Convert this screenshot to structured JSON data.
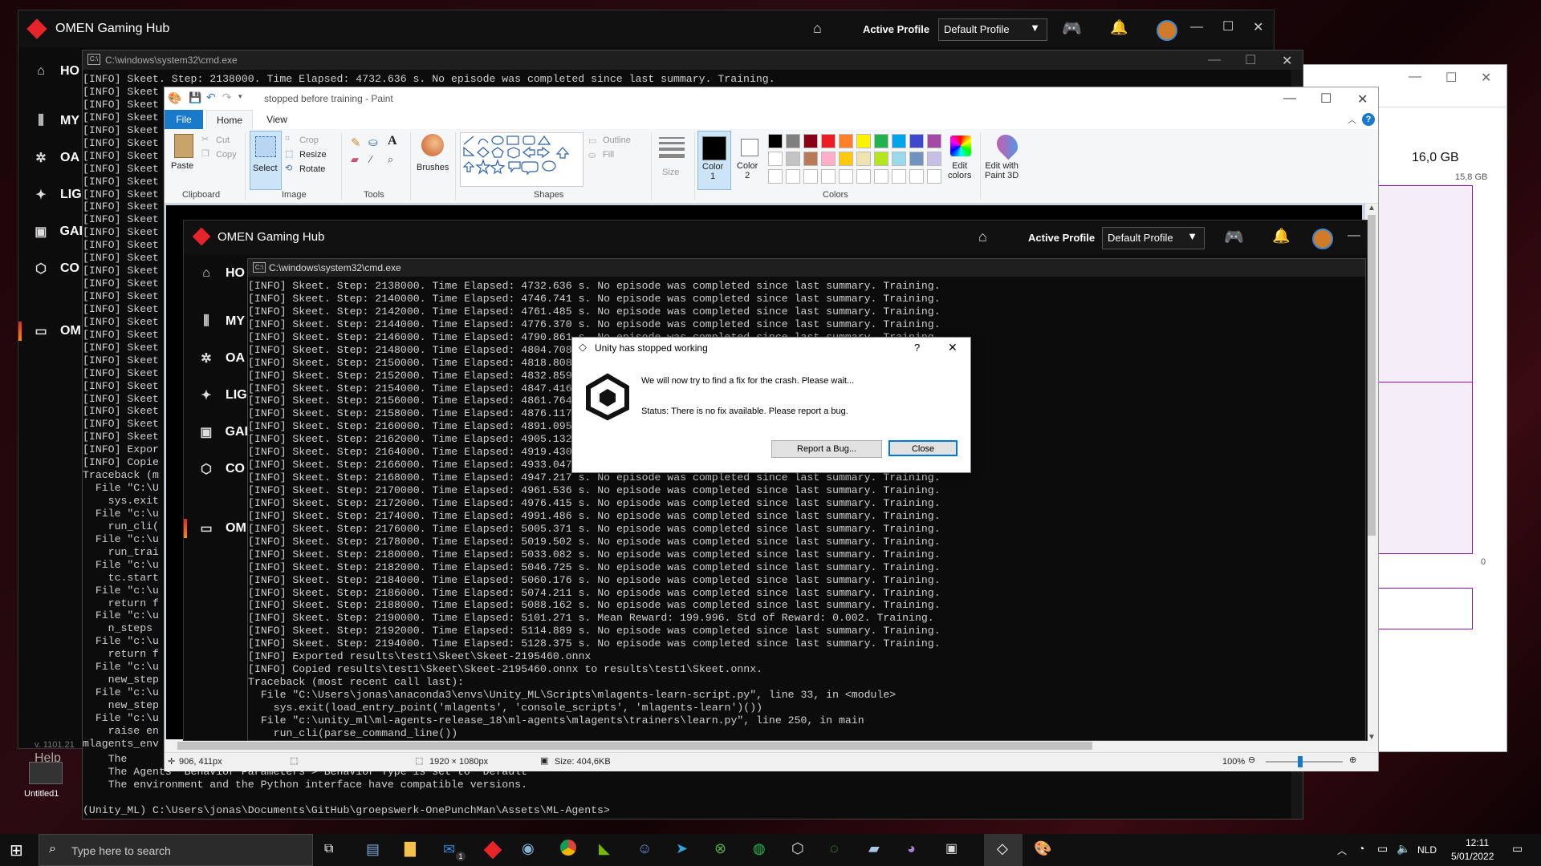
{
  "omen_back": {
    "title": "OMEN Gaming Hub",
    "active_profile_label": "Active Profile",
    "profile_value": "Default Profile",
    "nav": [
      "HO",
      "MY",
      "OA",
      "LIG",
      "GAI",
      "CO",
      "OM"
    ],
    "version": "v. 1101.21",
    "help": "Help"
  },
  "cmd_back": {
    "title": "C:\\windows\\system32\\cmd.exe",
    "first_line": "[INFO] Skeet. Step: 2138000. Time Elapsed: 4732.636 s. No episode was completed since last summary. Training.",
    "left_lines": [
      "[INFO] Skeet",
      "[INFO] Skeet",
      "[INFO] Skeet",
      "[INFO] Skeet",
      "[INFO] Skeet",
      "[INFO] Skeet",
      "[INFO] Skeet",
      "[INFO] Skeet",
      "[INFO] Skeet",
      "[INFO] Skeet",
      "[INFO] Skeet",
      "[INFO] Skeet",
      "[INFO] Skeet",
      "[INFO] Skeet",
      "[INFO] Skeet",
      "[INFO] Skeet",
      "[INFO] Skeet",
      "[INFO] Skeet",
      "[INFO] Skeet",
      "[INFO] Skeet",
      "[INFO] Skeet",
      "[INFO] Skeet",
      "[INFO] Skeet",
      "[INFO] Skeet",
      "[INFO] Skeet",
      "[INFO] Skeet",
      "[INFO] Skeet",
      "[INFO] Skeet",
      "[INFO] Expor",
      "[INFO] Copie",
      "Traceback (m",
      "  File \"C:\\U",
      "    sys.exit",
      "  File \"c:\\u",
      "    run_cli(",
      "  File \"c:\\u",
      "    run_trai",
      "  File \"c:\\u",
      "    tc.start",
      "  File \"c:\\u",
      "    return f",
      "  File \"c:\\u",
      "    n_steps",
      "  File \"c:\\u",
      "    return f",
      "  File \"c:\\u",
      "    new_step",
      "  File \"c:\\u",
      "    new_step",
      "  File \"c:\\u",
      "    raise en",
      "mlagents_env"
    ],
    "bottom_lines": [
      "    The",
      "    The Agents' Behavior Parameters > Behavior Type is set to \"Default\"",
      "    The environment and the Python interface have compatible versions.",
      "",
      "(Unity_ML) C:\\Users\\jonas\\Documents\\GitHub\\groepswerk-OnePunchMan\\Assets\\ML-Agents>"
    ]
  },
  "taskmgr": {
    "mem_total": "16,0 GB",
    "mem_avail": "15,8 GB",
    "zero": "0"
  },
  "paint": {
    "title": "stopped before training - Paint",
    "tabs": [
      "File",
      "Home",
      "View"
    ],
    "clipboard": {
      "paste": "Paste",
      "cut": "Cut",
      "copy": "Copy",
      "group": "Clipboard"
    },
    "image": {
      "select": "Select",
      "crop": "Crop",
      "resize": "Resize",
      "rotate": "Rotate",
      "group": "Image"
    },
    "tools_group": "Tools",
    "brushes": "Brushes",
    "shapes": {
      "outline": "Outline",
      "fill": "Fill",
      "group": "Shapes"
    },
    "size": "Size",
    "color1": "Color\n1",
    "color2": "Color\n2",
    "edit_colors": "Edit\ncolors",
    "edit_paint3d": "Edit with\nPaint 3D",
    "colors_group": "Colors",
    "palette_row1": [
      "#000000",
      "#7f7f7f",
      "#880015",
      "#ed1c24",
      "#ff7f27",
      "#fff200",
      "#22b14c",
      "#00a2e8",
      "#3f48cc",
      "#a349a4"
    ],
    "palette_row2": [
      "#ffffff",
      "#c3c3c3",
      "#b97a57",
      "#ffaec9",
      "#ffc90e",
      "#efe4b0",
      "#b5e61d",
      "#99d9ea",
      "#7092be",
      "#c8bfe7"
    ],
    "status_pos": "906, 411px",
    "status_dims": "1920 × 1080px",
    "status_size": "Size: 404,6KB",
    "zoom": "100%"
  },
  "omen_front": {
    "title": "OMEN Gaming Hub",
    "active_profile_label": "Active Profile",
    "profile_value": "Default Profile",
    "nav": [
      "HO",
      "MY",
      "OA",
      "LIG",
      "GAI",
      "CO",
      "OM"
    ]
  },
  "cmd_front": {
    "title": "C:\\windows\\system32\\cmd.exe",
    "lines": [
      "[INFO] Skeet. Step: 2138000. Time Elapsed: 4732.636 s. No episode was completed since last summary. Training.",
      "[INFO] Skeet. Step: 2140000. Time Elapsed: 4746.741 s. No episode was completed since last summary. Training.",
      "[INFO] Skeet. Step: 2142000. Time Elapsed: 4761.485 s. No episode was completed since last summary. Training.",
      "[INFO] Skeet. Step: 2144000. Time Elapsed: 4776.370 s. No episode was completed since last summary. Training.",
      "[INFO] Skeet. Step: 2146000. Time Elapsed: 4790.861 s. No episode was completed since last summary. Training.",
      "[INFO] Skeet. Step: 2148000. Time Elapsed: 4804.708",
      "[INFO] Skeet. Step: 2150000. Time Elapsed: 4818.808",
      "[INFO] Skeet. Step: 2152000. Time Elapsed: 4832.859",
      "[INFO] Skeet. Step: 2154000. Time Elapsed: 4847.416",
      "[INFO] Skeet. Step: 2156000. Time Elapsed: 4861.764",
      "[INFO] Skeet. Step: 2158000. Time Elapsed: 4876.117",
      "[INFO] Skeet. Step: 2160000. Time Elapsed: 4891.095",
      "[INFO] Skeet. Step: 2162000. Time Elapsed: 4905.132",
      "[INFO] Skeet. Step: 2164000. Time Elapsed: 4919.430",
      "[INFO] Skeet. Step: 2166000. Time Elapsed: 4933.047",
      "[INFO] Skeet. Step: 2168000. Time Elapsed: 4947.217 s. No episode was completed since last summary. Training.",
      "[INFO] Skeet. Step: 2170000. Time Elapsed: 4961.536 s. No episode was completed since last summary. Training.",
      "[INFO] Skeet. Step: 2172000. Time Elapsed: 4976.415 s. No episode was completed since last summary. Training.",
      "[INFO] Skeet. Step: 2174000. Time Elapsed: 4991.486 s. No episode was completed since last summary. Training.",
      "[INFO] Skeet. Step: 2176000. Time Elapsed: 5005.371 s. No episode was completed since last summary. Training.",
      "[INFO] Skeet. Step: 2178000. Time Elapsed: 5019.502 s. No episode was completed since last summary. Training.",
      "[INFO] Skeet. Step: 2180000. Time Elapsed: 5033.082 s. No episode was completed since last summary. Training.",
      "[INFO] Skeet. Step: 2182000. Time Elapsed: 5046.725 s. No episode was completed since last summary. Training.",
      "[INFO] Skeet. Step: 2184000. Time Elapsed: 5060.176 s. No episode was completed since last summary. Training.",
      "[INFO] Skeet. Step: 2186000. Time Elapsed: 5074.211 s. No episode was completed since last summary. Training.",
      "[INFO] Skeet. Step: 2188000. Time Elapsed: 5088.162 s. No episode was completed since last summary. Training.",
      "[INFO] Skeet. Step: 2190000. Time Elapsed: 5101.271 s. Mean Reward: 199.996. Std of Reward: 0.002. Training.",
      "[INFO] Skeet. Step: 2192000. Time Elapsed: 5114.889 s. No episode was completed since last summary. Training.",
      "[INFO] Skeet. Step: 2194000. Time Elapsed: 5128.375 s. No episode was completed since last summary. Training.",
      "[INFO] Exported results\\test1\\Skeet\\Skeet-2195460.onnx",
      "[INFO] Copied results\\test1\\Skeet\\Skeet-2195460.onnx to results\\test1\\Skeet.onnx.",
      "Traceback (most recent call last):",
      "  File \"C:\\Users\\jonas\\anaconda3\\envs\\Unity_ML\\Scripts\\mlagents-learn-script.py\", line 33, in <module>",
      "    sys.exit(load_entry_point('mlagents', 'console_scripts', 'mlagents-learn')())",
      "  File \"c:\\unity_ml\\ml-agents-release_18\\ml-agents\\mlagents\\trainers\\learn.py\", line 250, in main",
      "    run_cli(parse_command_line())"
    ]
  },
  "dialog": {
    "title": "Unity has stopped working",
    "help": "?",
    "message": "We will now try to find a fix for the crash. Please wait...",
    "status": "Status:  There is no fix available. Please report a bug.",
    "report_button": "Report a Bug...",
    "close_button": "Close"
  },
  "desktop": {
    "untitled_label": "Untitled1"
  },
  "taskbar": {
    "search_placeholder": "Type here to search",
    "language": "NLD",
    "time": "12:11",
    "date": "5/01/2022",
    "mail_badge": "1"
  }
}
